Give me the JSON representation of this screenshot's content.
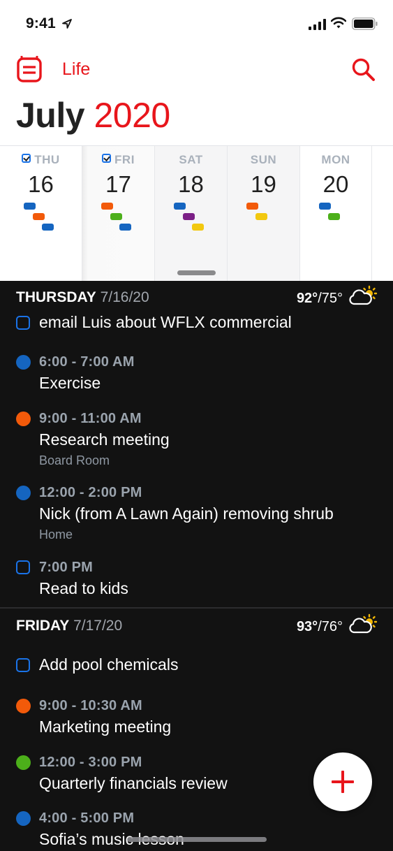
{
  "status_bar": {
    "time": "9:41",
    "icons": [
      "location-arrow-icon",
      "signal-icon",
      "wifi-icon",
      "battery-icon"
    ]
  },
  "nav": {
    "calendar_name": "Life",
    "left_icon": "calendar-list-icon",
    "right_icon": "search-icon"
  },
  "header": {
    "month": "July",
    "year": "2020"
  },
  "colors": {
    "accent": "#e8151b",
    "blue": "#1565c0",
    "orange": "#f25a0a",
    "green": "#4caf1a",
    "purple": "#7b1f86",
    "yellow": "#f2c80f",
    "task_blue": "#1a73e8"
  },
  "week": [
    {
      "weekday": "THU",
      "day": "16",
      "has_task": true,
      "chips": [
        "blue",
        "orange",
        "blue"
      ]
    },
    {
      "weekday": "FRI",
      "day": "17",
      "has_task": true,
      "chips": [
        "orange",
        "green",
        "blue"
      ]
    },
    {
      "weekday": "SAT",
      "day": "18",
      "has_task": false,
      "chips": [
        "blue",
        "purple",
        "yellow"
      ]
    },
    {
      "weekday": "SUN",
      "day": "19",
      "has_task": false,
      "chips": [
        "orange",
        "yellow"
      ]
    },
    {
      "weekday": "MON",
      "day": "20",
      "has_task": false,
      "chips": [
        "blue",
        "green"
      ]
    }
  ],
  "agenda": [
    {
      "day_name": "THURSDAY",
      "date": "7/16/20",
      "weather": {
        "high": "92°",
        "low": "/75°",
        "icon": "partly-sunny-icon"
      },
      "items": [
        {
          "kind": "task",
          "title": "email Luis about WFLX commercial"
        },
        {
          "kind": "event",
          "color": "blue",
          "time": "6:00 - 7:00 AM",
          "title": "Exercise"
        },
        {
          "kind": "event",
          "color": "orange",
          "time": "9:00 - 11:00 AM",
          "title": "Research meeting",
          "location": "Board Room"
        },
        {
          "kind": "event",
          "color": "blue",
          "time": "12:00 - 2:00 PM",
          "title": "Nick (from A Lawn Again) removing shrub",
          "location": "Home"
        },
        {
          "kind": "task",
          "time": "7:00 PM",
          "title": "Read to kids"
        }
      ]
    },
    {
      "day_name": "FRIDAY",
      "date": "7/17/20",
      "weather": {
        "high": "93°",
        "low": "/76°",
        "icon": "partly-sunny-icon"
      },
      "items": [
        {
          "kind": "task",
          "title": "Add pool chemicals"
        },
        {
          "kind": "event",
          "color": "orange",
          "time": "9:00 - 10:30 AM",
          "title": "Marketing meeting"
        },
        {
          "kind": "event",
          "color": "green",
          "time": "12:00 - 3:00 PM",
          "title": "Quarterly financials review"
        },
        {
          "kind": "event",
          "color": "blue",
          "time": "4:00 - 5:00 PM",
          "title": "Sofia’s music lesson"
        }
      ]
    }
  ],
  "fab": {
    "icon": "plus-icon",
    "label": "Add"
  }
}
